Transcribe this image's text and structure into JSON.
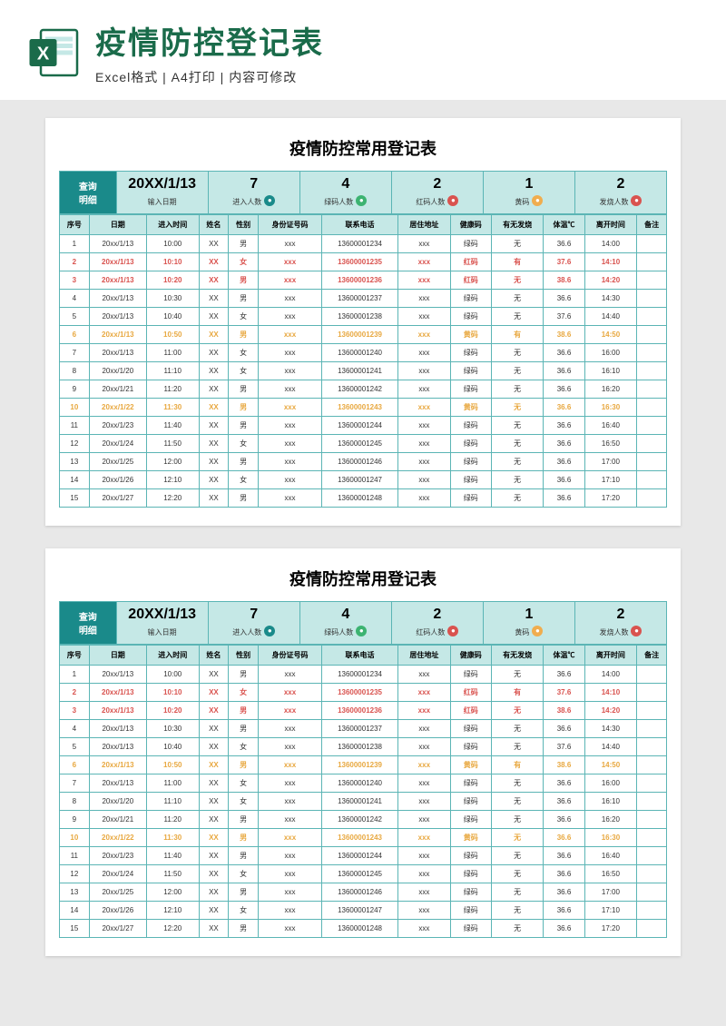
{
  "header": {
    "title": "疫情防控登记表",
    "subtitle": "Excel格式 | A4打印 | 内容可修改"
  },
  "page": {
    "title": "疫情防控常用登记表",
    "summary": {
      "query_label": "查询\n明细",
      "date_value": "20XX/1/13",
      "date_label": "输入日期",
      "total_value": "7",
      "total_label": "进入人数",
      "green_value": "4",
      "green_label": "绿码人数",
      "red_value": "2",
      "red_label": "红码人数",
      "yellow_value": "1",
      "yellow_label": "黄码",
      "fever_value": "2",
      "fever_label": "发烧人数"
    },
    "columns": [
      "序号",
      "日期",
      "进入时间",
      "姓名",
      "性别",
      "身份证号码",
      "联系电话",
      "居住地址",
      "健康码",
      "有无发烧",
      "体温℃",
      "离开时间",
      "备注"
    ],
    "rows": [
      {
        "c": "",
        "d": [
          "1",
          "20xx/1/13",
          "10:00",
          "XX",
          "男",
          "xxx",
          "13600001234",
          "xxx",
          "绿码",
          "无",
          "36.6",
          "14:00",
          ""
        ]
      },
      {
        "c": "red",
        "d": [
          "2",
          "20xx/1/13",
          "10:10",
          "XX",
          "女",
          "xxx",
          "13600001235",
          "xxx",
          "红码",
          "有",
          "37.6",
          "14:10",
          ""
        ]
      },
      {
        "c": "red",
        "d": [
          "3",
          "20xx/1/13",
          "10:20",
          "XX",
          "男",
          "xxx",
          "13600001236",
          "xxx",
          "红码",
          "无",
          "38.6",
          "14:20",
          ""
        ]
      },
      {
        "c": "",
        "d": [
          "4",
          "20xx/1/13",
          "10:30",
          "XX",
          "男",
          "xxx",
          "13600001237",
          "xxx",
          "绿码",
          "无",
          "36.6",
          "14:30",
          ""
        ]
      },
      {
        "c": "",
        "d": [
          "5",
          "20xx/1/13",
          "10:40",
          "XX",
          "女",
          "xxx",
          "13600001238",
          "xxx",
          "绿码",
          "无",
          "37.6",
          "14:40",
          ""
        ]
      },
      {
        "c": "orange",
        "d": [
          "6",
          "20xx/1/13",
          "10:50",
          "XX",
          "男",
          "xxx",
          "13600001239",
          "xxx",
          "黄码",
          "有",
          "38.6",
          "14:50",
          ""
        ]
      },
      {
        "c": "",
        "d": [
          "7",
          "20xx/1/13",
          "11:00",
          "XX",
          "女",
          "xxx",
          "13600001240",
          "xxx",
          "绿码",
          "无",
          "36.6",
          "16:00",
          ""
        ]
      },
      {
        "c": "",
        "d": [
          "8",
          "20xx/1/20",
          "11:10",
          "XX",
          "女",
          "xxx",
          "13600001241",
          "xxx",
          "绿码",
          "无",
          "36.6",
          "16:10",
          ""
        ]
      },
      {
        "c": "",
        "d": [
          "9",
          "20xx/1/21",
          "11:20",
          "XX",
          "男",
          "xxx",
          "13600001242",
          "xxx",
          "绿码",
          "无",
          "36.6",
          "16:20",
          ""
        ]
      },
      {
        "c": "orange",
        "d": [
          "10",
          "20xx/1/22",
          "11:30",
          "XX",
          "男",
          "xxx",
          "13600001243",
          "xxx",
          "黄码",
          "无",
          "36.6",
          "16:30",
          ""
        ]
      },
      {
        "c": "",
        "d": [
          "11",
          "20xx/1/23",
          "11:40",
          "XX",
          "男",
          "xxx",
          "13600001244",
          "xxx",
          "绿码",
          "无",
          "36.6",
          "16:40",
          ""
        ]
      },
      {
        "c": "",
        "d": [
          "12",
          "20xx/1/24",
          "11:50",
          "XX",
          "女",
          "xxx",
          "13600001245",
          "xxx",
          "绿码",
          "无",
          "36.6",
          "16:50",
          ""
        ]
      },
      {
        "c": "",
        "d": [
          "13",
          "20xx/1/25",
          "12:00",
          "XX",
          "男",
          "xxx",
          "13600001246",
          "xxx",
          "绿码",
          "无",
          "36.6",
          "17:00",
          ""
        ]
      },
      {
        "c": "",
        "d": [
          "14",
          "20xx/1/26",
          "12:10",
          "XX",
          "女",
          "xxx",
          "13600001247",
          "xxx",
          "绿码",
          "无",
          "36.6",
          "17:10",
          ""
        ]
      },
      {
        "c": "",
        "d": [
          "15",
          "20xx/1/27",
          "12:20",
          "XX",
          "男",
          "xxx",
          "13600001248",
          "xxx",
          "绿码",
          "无",
          "36.6",
          "17:20",
          ""
        ]
      }
    ]
  }
}
